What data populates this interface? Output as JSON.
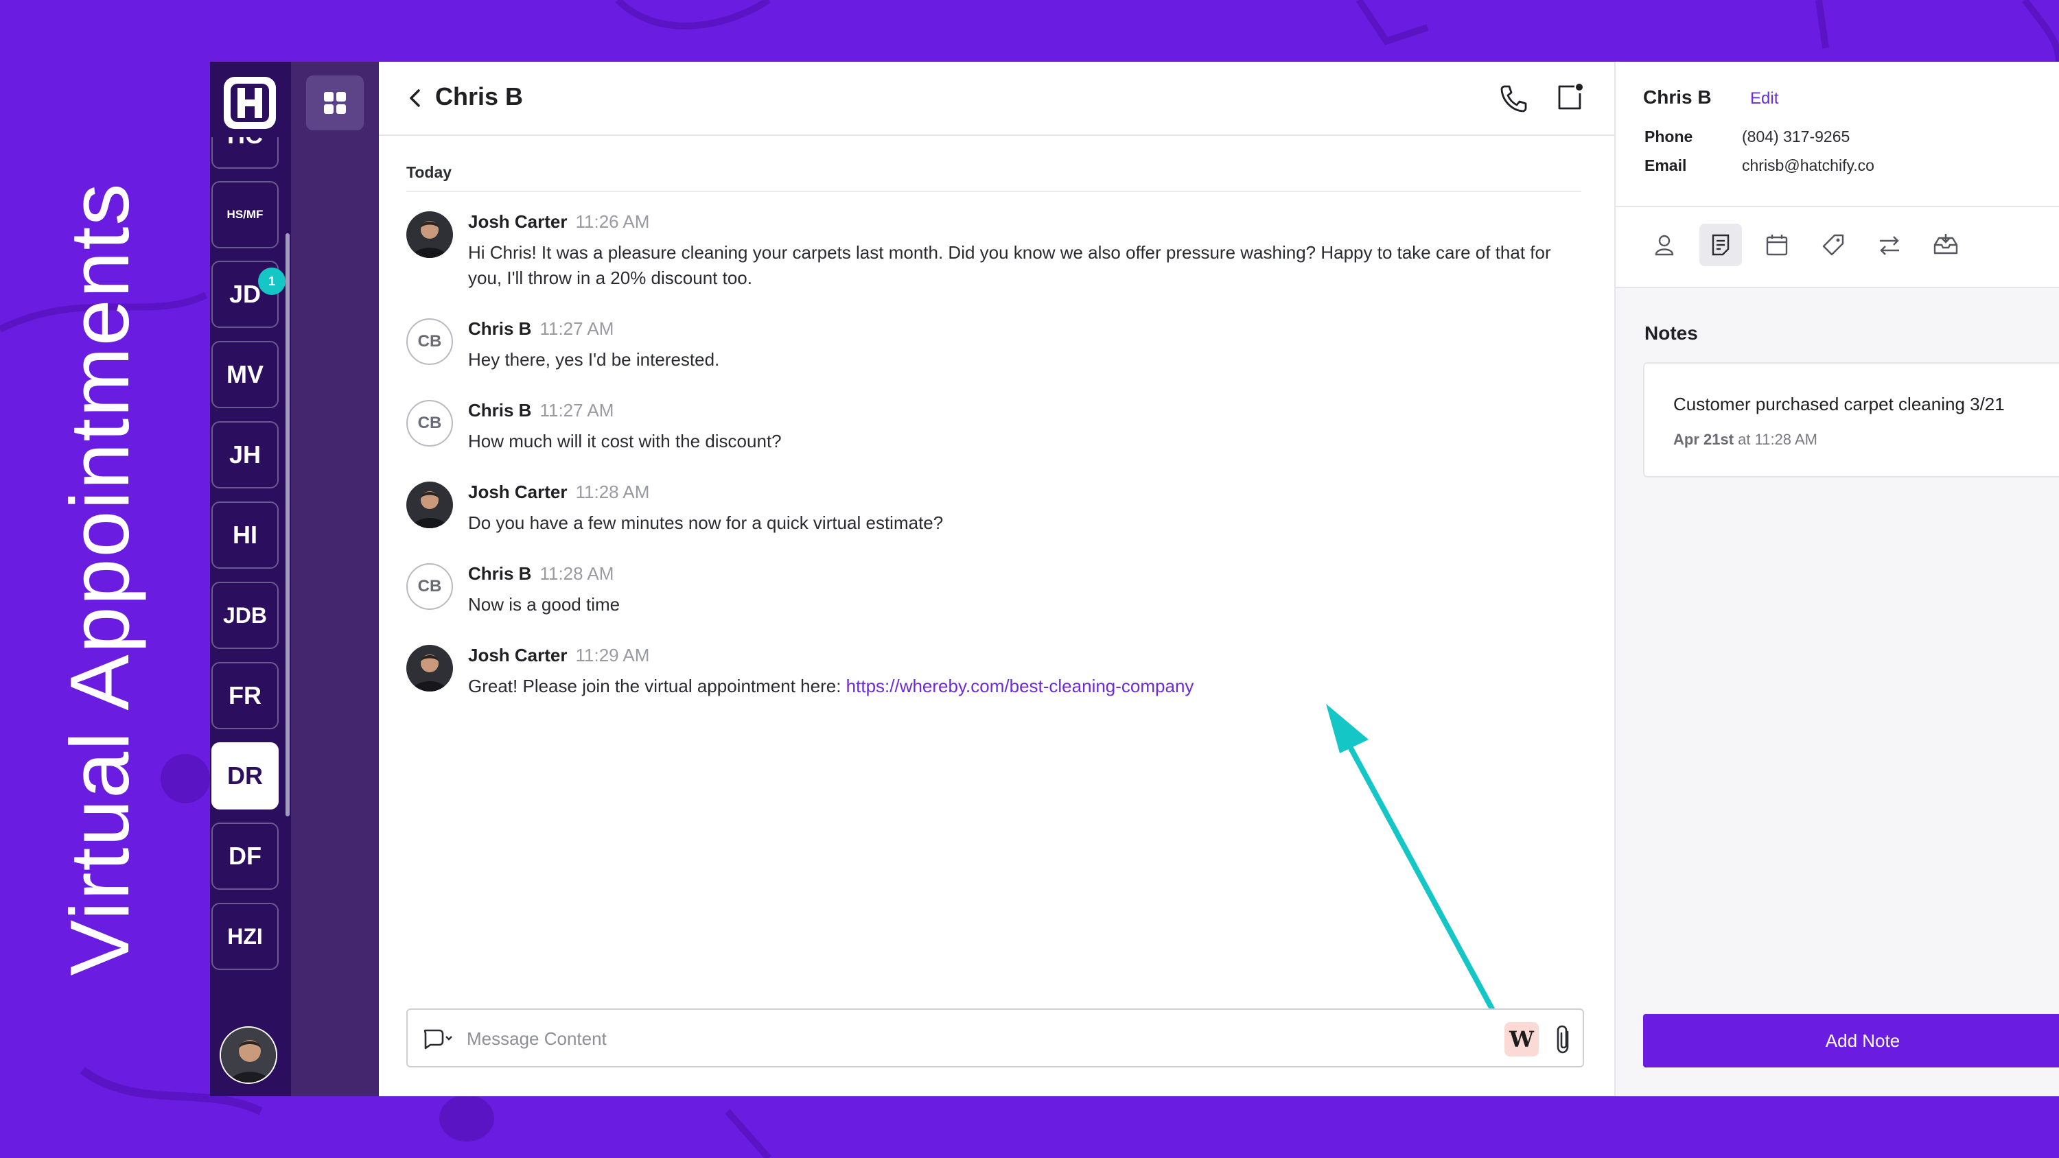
{
  "slide": {
    "title": "Virtual Appointments"
  },
  "colors": {
    "brand": "#6a1de0",
    "rail": "#2b0f5e",
    "accent_arrow": "#14c6c6",
    "link": "#6c2bd9"
  },
  "rail": {
    "logo_icon": "hatchify-logo",
    "tiles": [
      {
        "label": "HC",
        "small": false,
        "active": false,
        "badge": ""
      },
      {
        "label": "HS/MF",
        "small": true,
        "active": false,
        "badge": ""
      },
      {
        "label": "JD",
        "small": false,
        "active": false,
        "badge": "1"
      },
      {
        "label": "MV",
        "small": false,
        "active": false,
        "badge": ""
      },
      {
        "label": "JH",
        "small": false,
        "active": false,
        "badge": ""
      },
      {
        "label": "HI",
        "small": false,
        "active": false,
        "badge": ""
      },
      {
        "label": "JDB",
        "small": false,
        "active": false,
        "badge": ""
      },
      {
        "label": "FR",
        "small": false,
        "active": false,
        "badge": ""
      },
      {
        "label": "DR",
        "small": false,
        "active": true,
        "badge": ""
      },
      {
        "label": "DF",
        "small": false,
        "active": false,
        "badge": ""
      },
      {
        "label": "HZI",
        "small": false,
        "active": false,
        "badge": ""
      }
    ]
  },
  "header": {
    "title": "Chris B"
  },
  "conversation": {
    "day": "Today",
    "messages": [
      {
        "sender": "Josh Carter",
        "time": "11:26 AM",
        "avatar": "photo",
        "text": "Hi Chris! It was a pleasure cleaning your carpets last month. Did you know we also offer pressure washing? Happy to take care of that for you, I'll throw in a 20% discount too.",
        "link": ""
      },
      {
        "sender": "Chris B",
        "time": "11:27 AM",
        "avatar": "CB",
        "text": "Hey there, yes I'd be interested.",
        "link": ""
      },
      {
        "sender": "Chris B",
        "time": "11:27 AM",
        "avatar": "CB",
        "text": "How much will it cost with the discount?",
        "link": ""
      },
      {
        "sender": "Josh Carter",
        "time": "11:28 AM",
        "avatar": "photo",
        "text": "Do you have a few minutes now for a quick virtual estimate?",
        "link": ""
      },
      {
        "sender": "Chris B",
        "time": "11:28 AM",
        "avatar": "CB",
        "text": "Now is a good time",
        "link": ""
      },
      {
        "sender": "Josh Carter",
        "time": "11:29 AM",
        "avatar": "photo",
        "text": "Great! Please join the virtual appointment here: ",
        "link": "https://whereby.com/best-cleaning-company"
      }
    ]
  },
  "composer": {
    "placeholder": "Message Content",
    "whereby_label": "W"
  },
  "contact": {
    "name": "Chris B",
    "edit_label": "Edit",
    "phone_label": "Phone",
    "phone": "(804) 317-9265",
    "email_label": "Email",
    "email": "chrisb@hatchify.co",
    "tabs": [
      "person-icon",
      "notes-icon",
      "calendar-icon",
      "tag-icon",
      "transfer-icon",
      "inbox-icon"
    ]
  },
  "notes": {
    "title": "Notes",
    "items": [
      {
        "text": "Customer purchased carpet cleaning 3/21",
        "date": "Apr 21st",
        "time_text": " at 11:28 AM"
      }
    ],
    "add_label": "Add Note"
  }
}
